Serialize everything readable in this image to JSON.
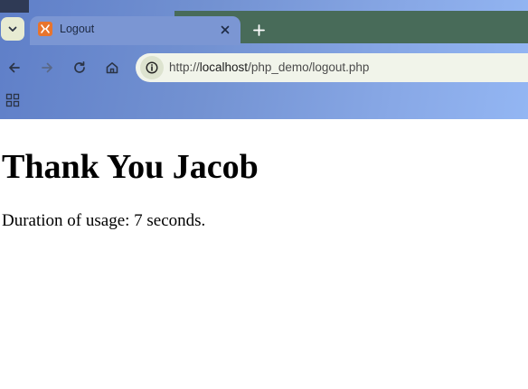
{
  "browser": {
    "tab": {
      "title": "Logout",
      "favicon": "xampp-icon"
    },
    "address_bar": {
      "url_prefix": "http://",
      "url_host": "localhost",
      "url_path": "/php_demo/logout.php"
    },
    "colors": {
      "accent": "#7b96d3",
      "tabstrip": "#486b59"
    }
  },
  "page": {
    "heading": "Thank You Jacob",
    "usage_text": "Duration of usage: 7 seconds."
  }
}
